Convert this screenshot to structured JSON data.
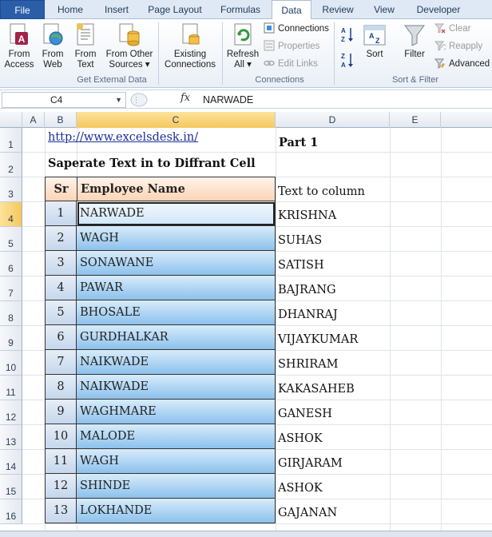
{
  "ribbon_tabs": [
    {
      "label": "File"
    },
    {
      "label": "Home"
    },
    {
      "label": "Insert"
    },
    {
      "label": "Page Layout"
    },
    {
      "label": "Formulas"
    },
    {
      "label": "Data"
    },
    {
      "label": "Review"
    },
    {
      "label": "View"
    },
    {
      "label": "Developer"
    }
  ],
  "groups": {
    "external": {
      "label": "Get External Data",
      "from_access": "From Access",
      "from_web": "From Web",
      "from_text": "From Text",
      "from_other": "From Other Sources",
      "existing": "Existing Connections"
    },
    "connections": {
      "label": "Connections",
      "refresh": "Refresh All",
      "connections": "Connections",
      "properties": "Properties",
      "edit_links": "Edit Links"
    },
    "sortfilter": {
      "label": "Sort & Filter",
      "sort": "Sort",
      "filter": "Filter",
      "clear": "Clear",
      "reapply": "Reapply",
      "advanced": "Advanced"
    }
  },
  "formula_bar": {
    "name_box": "C4",
    "fx": "fx",
    "value": "NARWADE"
  },
  "columns": [
    "A",
    "B",
    "C",
    "D",
    "E"
  ],
  "rows": [
    "1",
    "2",
    "3",
    "4",
    "5",
    "6",
    "7",
    "8",
    "9",
    "10",
    "11",
    "12",
    "13",
    "14",
    "15",
    "16"
  ],
  "sheet": {
    "link": "http://www.excelsdesk.in/",
    "title": "Saperate Text in to Diffrant Cell",
    "part": "Part 1",
    "text_to_column": "Text to column",
    "header_sr": "Sr",
    "header_name": "Employee Name",
    "records": [
      {
        "sr": "1",
        "name": "NARWADE",
        "d": "KRISHNA"
      },
      {
        "sr": "2",
        "name": "WAGH",
        "d": "SUHAS"
      },
      {
        "sr": "3",
        "name": "SONAWANE",
        "d": "SATISH"
      },
      {
        "sr": "4",
        "name": "PAWAR",
        "d": "BAJRANG"
      },
      {
        "sr": "5",
        "name": "BHOSALE",
        "d": "DHANRAJ"
      },
      {
        "sr": "6",
        "name": "GURDHALKAR",
        "d": "VIJAYKUMAR"
      },
      {
        "sr": "7",
        "name": "NAIKWADE",
        "d": "SHRIRAM"
      },
      {
        "sr": "8",
        "name": "NAIKWADE",
        "d": "KAKASAHEB"
      },
      {
        "sr": "9",
        "name": "WAGHMARE",
        "d": "GANESH"
      },
      {
        "sr": "10",
        "name": "MALODE",
        "d": "ASHOK"
      },
      {
        "sr": "11",
        "name": "WAGH",
        "d": "GIRJARAM"
      },
      {
        "sr": "12",
        "name": "SHINDE",
        "d": "ASHOK"
      },
      {
        "sr": "13",
        "name": "LOKHANDE",
        "d": "GAJANAN"
      }
    ]
  }
}
